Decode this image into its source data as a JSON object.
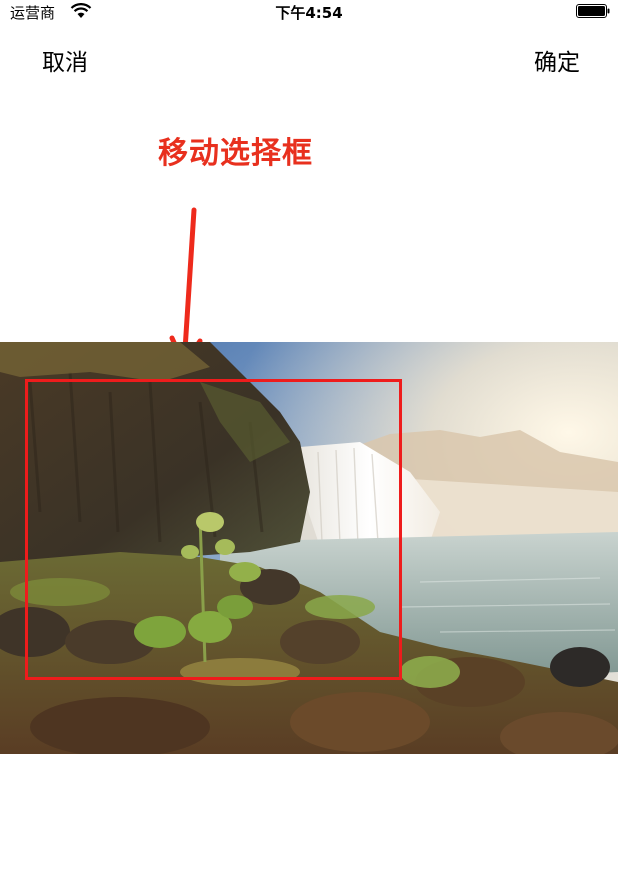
{
  "status_bar": {
    "carrier": "运营商",
    "time": "下午4:54",
    "wifi_icon": "wifi-icon",
    "battery_icon": "battery-icon"
  },
  "nav": {
    "cancel_label": "取消",
    "confirm_label": "确定"
  },
  "annotation": {
    "text": "移动选择框",
    "color": "#e8301e",
    "arrow_icon": "arrow-down-icon"
  },
  "photo": {
    "subject": "waterfall-landscape-photo"
  },
  "crop_box": {
    "border_color": "#ee1c1c"
  }
}
